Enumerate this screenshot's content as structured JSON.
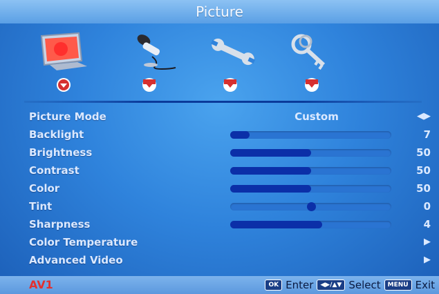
{
  "menu": {
    "title": "Picture"
  },
  "tabs": [
    {
      "icon": "tv-picture-icon",
      "active": true
    },
    {
      "icon": "microphone-sound-icon",
      "active": false
    },
    {
      "icon": "wrench-setup-icon",
      "active": false
    },
    {
      "icon": "key-lock-icon",
      "active": false
    }
  ],
  "settings": {
    "picture_mode": {
      "label": "Picture Mode",
      "value": "Custom",
      "control_icon": "left-right-arrows-icon"
    },
    "backlight": {
      "label": "Backlight",
      "value": "7",
      "level": 7,
      "max": 100
    },
    "brightness": {
      "label": "Brightness",
      "value": "50",
      "level": 50,
      "max": 100
    },
    "contrast": {
      "label": "Contrast",
      "value": "50",
      "level": 50,
      "max": 100
    },
    "color": {
      "label": "Color",
      "value": "50",
      "level": 50,
      "max": 100
    },
    "tint": {
      "label": "Tint",
      "value": "0",
      "level": 0,
      "min": -50,
      "max": 50
    },
    "sharpness": {
      "label": "Sharpness",
      "value": "4",
      "level": 4,
      "max": 7
    },
    "color_temperature": {
      "label": "Color Temperature",
      "control_icon": "right-arrow-icon"
    },
    "advanced_video": {
      "label": "Advanced Video",
      "control_icon": "right-arrow-icon"
    }
  },
  "footer": {
    "source": "AV1",
    "ok_key": "OK",
    "enter": "Enter",
    "nav_key": "◀▶/▲▼",
    "select": "Select",
    "menu_key": "MENU",
    "exit": "Exit"
  },
  "colors": {
    "background": "#2f83dc",
    "title_bar": "#8cc2f3",
    "slider_fill": "#0b2fa8",
    "slider_track": "#2a74d2",
    "label_text": "#dbe9ff",
    "source_text": "#e23030",
    "marker_red": "#d63030"
  }
}
